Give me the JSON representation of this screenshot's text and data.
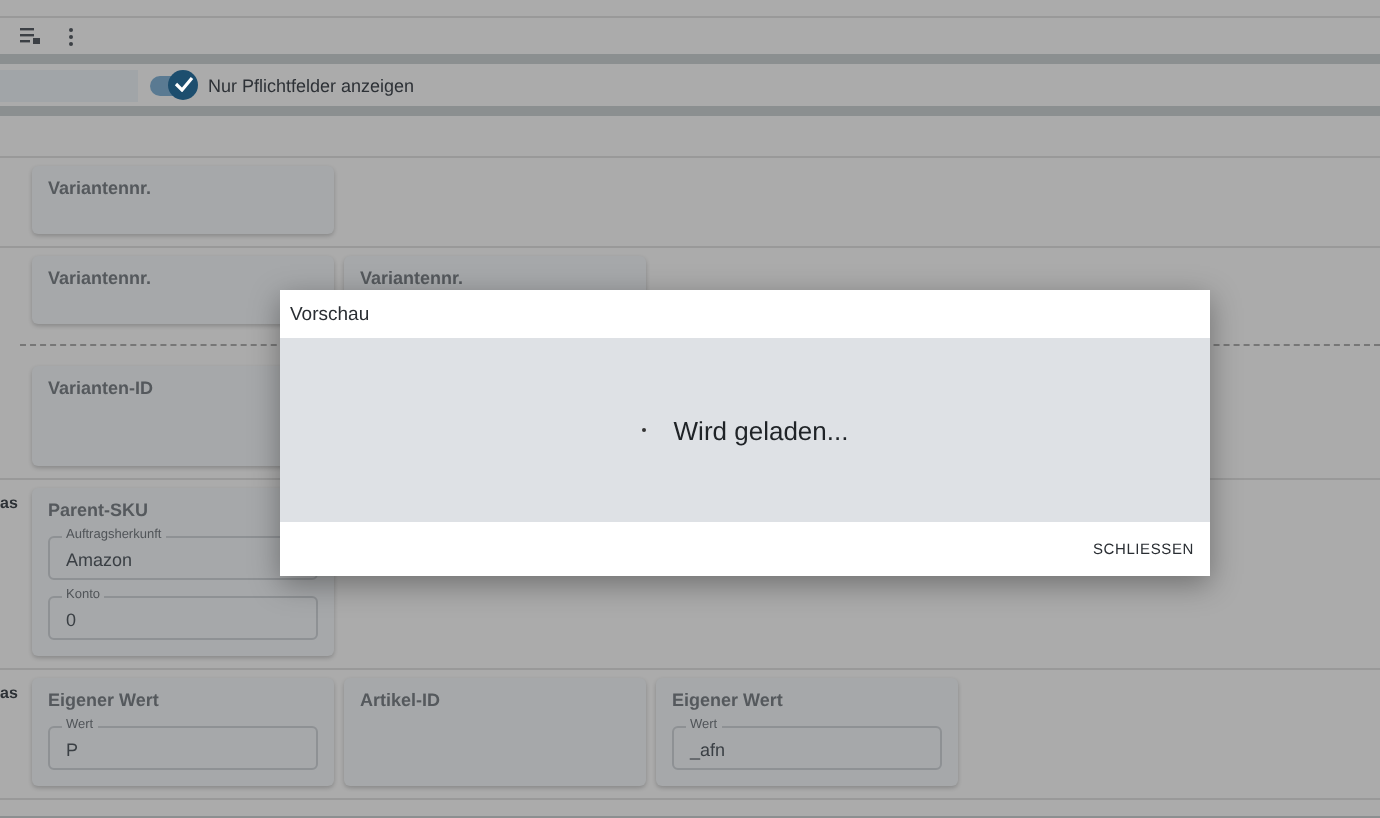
{
  "filter": {
    "toggle": {
      "label": "Nur Pflichtfelder anzeigen",
      "on": true
    }
  },
  "sections": [
    {
      "rows": [
        [
          {
            "title": "Variantennr."
          }
        ]
      ]
    },
    {
      "rows": [
        [
          {
            "title": "Variantennr."
          },
          {
            "title": "Variantennr."
          }
        ],
        [
          {
            "title": "Varianten-ID",
            "tall": true
          }
        ]
      ]
    },
    {
      "label": "as",
      "rows": [
        [
          {
            "title": "Parent-SKU",
            "fields": [
              {
                "label": "Auftragsherkunft",
                "value": "Amazon"
              },
              {
                "label": "Konto",
                "value": "0"
              }
            ]
          }
        ]
      ]
    },
    {
      "label": "as",
      "rows": [
        [
          {
            "title": "Eigener Wert",
            "fields": [
              {
                "label": "Wert",
                "value": "P"
              }
            ]
          },
          {
            "title": "Artikel-ID"
          },
          {
            "title": "Eigener Wert",
            "fields": [
              {
                "label": "Wert",
                "value": "_afn"
              }
            ]
          }
        ]
      ]
    }
  ],
  "dialog": {
    "title": "Vorschau",
    "message": "Wird geladen...",
    "button": "SCHLIESSEN"
  }
}
